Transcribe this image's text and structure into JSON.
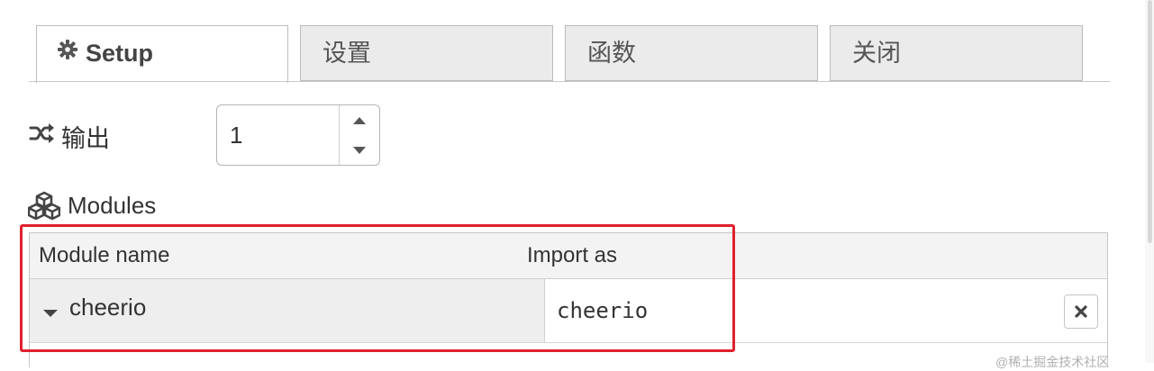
{
  "tabs": [
    {
      "label": "Setup",
      "icon": "gear-icon",
      "active": true
    },
    {
      "label": "设置",
      "active": false
    },
    {
      "label": "函数",
      "active": false
    },
    {
      "label": "关闭",
      "active": false
    }
  ],
  "outputs": {
    "icon": "shuffle-icon",
    "label": "输出",
    "value": "1"
  },
  "modules": {
    "icon": "cubes-icon",
    "label": "Modules",
    "columns": {
      "module_name": "Module name",
      "import_as": "Import as"
    },
    "rows": [
      {
        "module_name": "cheerio",
        "import_as": "cheerio"
      }
    ]
  },
  "watermark": "@稀土掘金技术社区",
  "colors": {
    "highlight": "#e0202e",
    "tab_bg": "#ebebeb",
    "header_bg": "#f3f3f3"
  }
}
